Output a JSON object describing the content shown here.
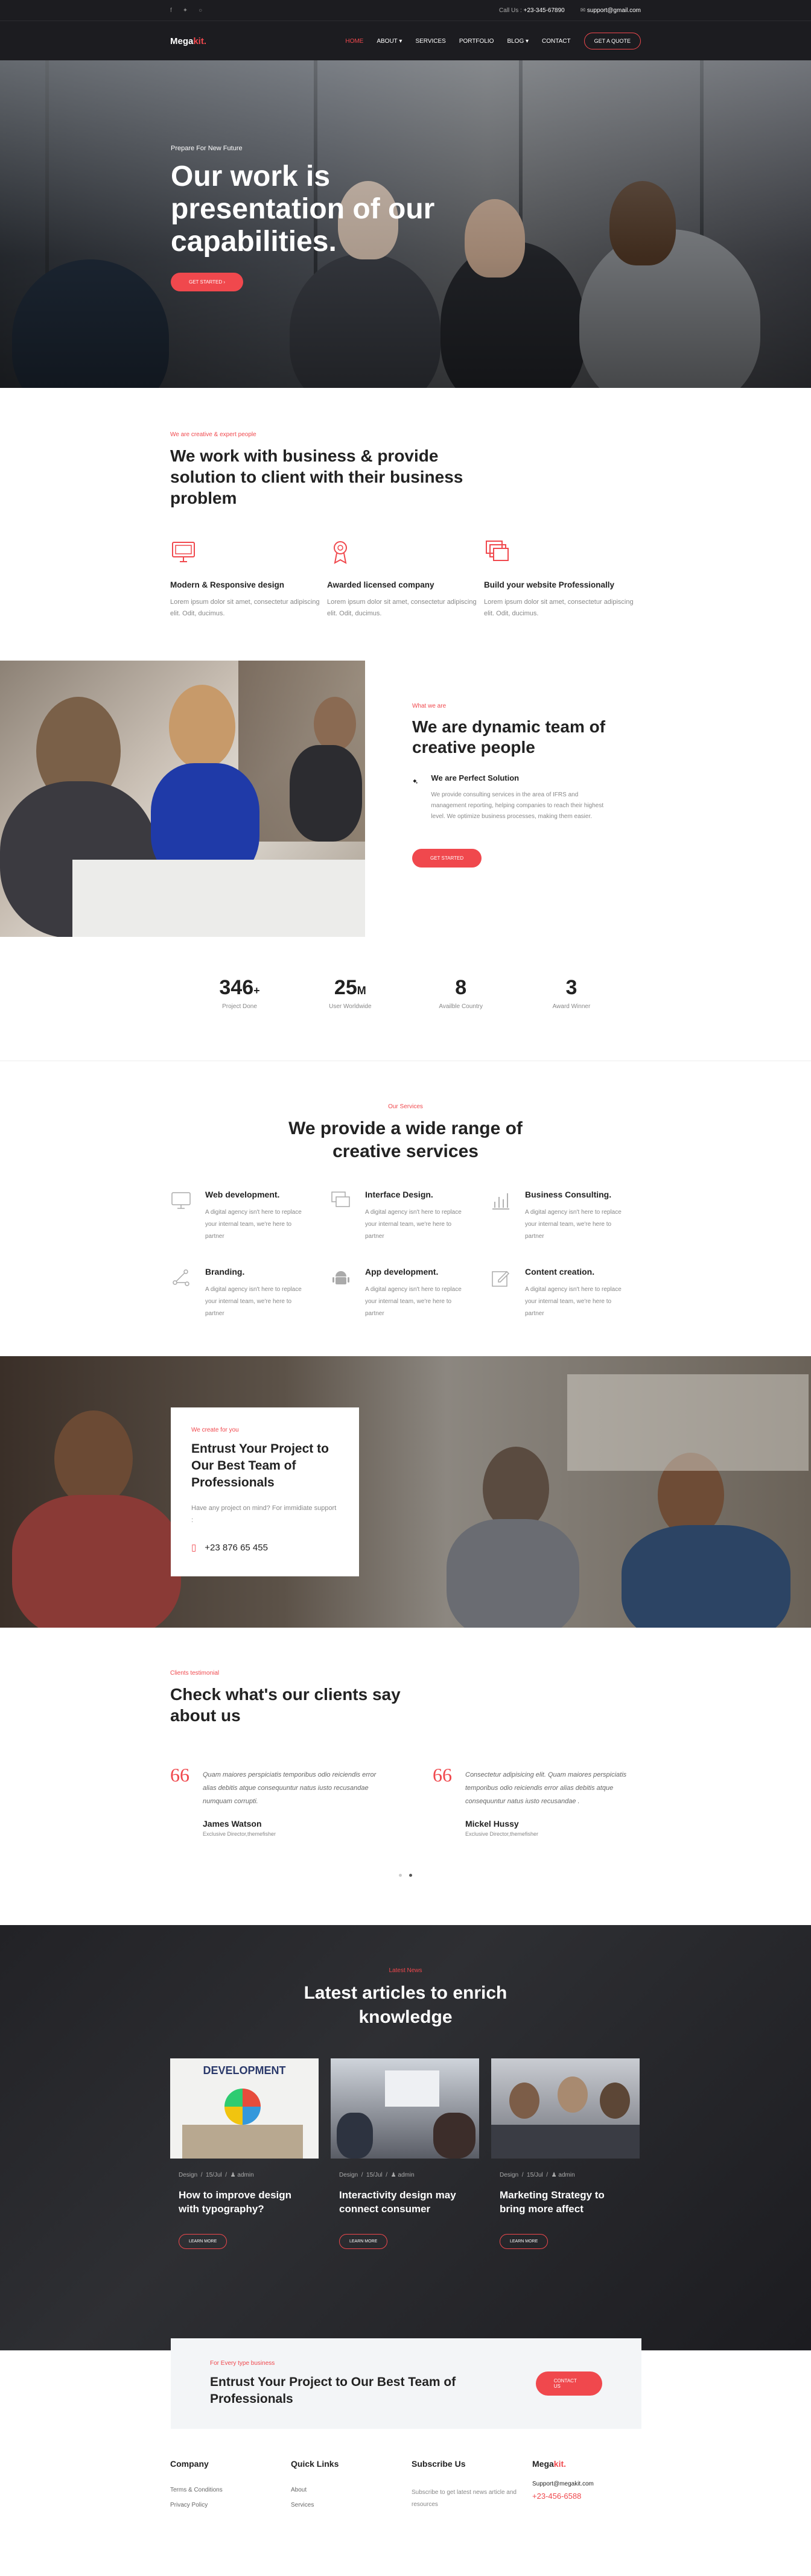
{
  "topbar": {
    "call_label": "Call Us :",
    "phone": "+23-345-67890",
    "email": "support@gmail.com"
  },
  "nav": {
    "logo_main": "Mega",
    "logo_accent": "kit.",
    "items": [
      "HOME",
      "ABOUT",
      "SERVICES",
      "PORTFOLIO",
      "BLOG",
      "CONTACT"
    ],
    "quote_button": "GET A QUOTE"
  },
  "hero": {
    "eyebrow": "Prepare For New Future",
    "title": "Our work is presentation of our capabilities.",
    "button": "GET STARTED"
  },
  "intro": {
    "eyebrow": "We are creative & expert people",
    "title": "We work with business & provide solution to client with their business problem",
    "features": [
      {
        "title": "Modern & Responsive design",
        "text": "Lorem ipsum dolor sit amet, consectetur adipiscing elit. Odit, ducimus."
      },
      {
        "title": "Awarded licensed company",
        "text": "Lorem ipsum dolor sit amet, consectetur adipiscing elit. Odit, ducimus."
      },
      {
        "title": "Build your website Professionally",
        "text": "Lorem ipsum dolor sit amet, consectetur adipiscing elit. Odit, ducimus."
      }
    ]
  },
  "team": {
    "eyebrow": "What we are",
    "title": "We are dynamic team of creative people",
    "solution_title": "We are Perfect Solution",
    "solution_text": "We provide consulting services in the area of IFRS and management reporting, helping companies to reach their highest level. We optimize business processes, making them easier.",
    "button": "GET STARTED"
  },
  "stats": [
    {
      "num": "346",
      "suffix": "+",
      "label": "Project Done"
    },
    {
      "num": "25",
      "suffix": "M",
      "label": "User Worldwide"
    },
    {
      "num": "8",
      "suffix": "",
      "label": "Availble Country"
    },
    {
      "num": "3",
      "suffix": "",
      "label": "Award Winner"
    }
  ],
  "services": {
    "eyebrow": "Our Services",
    "title": "We provide a wide range of creative services",
    "items": [
      {
        "title": "Web development.",
        "text": "A digital agency isn't here to replace your internal team, we're here to partner"
      },
      {
        "title": "Interface Design.",
        "text": "A digital agency isn't here to replace your internal team, we're here to partner"
      },
      {
        "title": "Business Consulting.",
        "text": "A digital agency isn't here to replace your internal team, we're here to partner"
      },
      {
        "title": "Branding.",
        "text": "A digital agency isn't here to replace your internal team, we're here to partner"
      },
      {
        "title": "App development.",
        "text": "A digital agency isn't here to replace your internal team, we're here to partner"
      },
      {
        "title": "Content creation.",
        "text": "A digital agency isn't here to replace your internal team, we're here to partner"
      }
    ]
  },
  "project": {
    "eyebrow": "We create for you",
    "title": "Entrust Your Project to Our Best Team of Professionals",
    "text": "Have any project on mind? For immidiate support :",
    "phone": "+23 876 65 455"
  },
  "testimonials": {
    "eyebrow": "Clients testimonial",
    "title": "Check what's our clients say about us",
    "items": [
      {
        "quote": "Quam maiores perspiciatis temporibus odio reiciendis error alias debitis atque consequuntur natus iusto recusandae numquam corrupti.",
        "name": "James Watson",
        "role": "Exclusive Director,themefisher"
      },
      {
        "quote": "Consectetur adipisicing elit. Quam maiores perspiciatis temporibus odio reiciendis error alias debitis atque consequuntur natus iusto recusandae .",
        "name": "Mickel Hussy",
        "role": "Exclusive Director,themefisher"
      }
    ]
  },
  "news": {
    "eyebrow": "Latest News",
    "title": "Latest articles to enrich knowledge",
    "thumb_caption": "DEVELOPMENT",
    "items": [
      {
        "category": "Design",
        "date": "15/Jul",
        "author": "admin",
        "title": "How to improve design with typography?",
        "button": "LEARN MORE"
      },
      {
        "category": "Design",
        "date": "15/Jul",
        "author": "admin",
        "title": "Interactivity design may connect consumer",
        "button": "LEARN MORE"
      },
      {
        "category": "Design",
        "date": "15/Jul",
        "author": "admin",
        "title": "Marketing Strategy to bring more affect",
        "button": "LEARN MORE"
      }
    ]
  },
  "cta": {
    "eyebrow": "For Every type business",
    "title": "Entrust Your Project to Our Best Team of Professionals",
    "button": "CONTACT US"
  },
  "footer": {
    "company_title": "Company",
    "company_links": [
      "Terms & Conditions",
      "Privacy Policy"
    ],
    "quick_title": "Quick Links",
    "quick_links": [
      "About",
      "Services"
    ],
    "subscribe_title": "Subscribe Us",
    "subscribe_text": "Subscribe to get latest news article and resources",
    "email": "Support@megakit.com",
    "phone": "+23-456-6588"
  },
  "colors": {
    "accent": "#f0484d",
    "dark": "#1c1c20"
  }
}
